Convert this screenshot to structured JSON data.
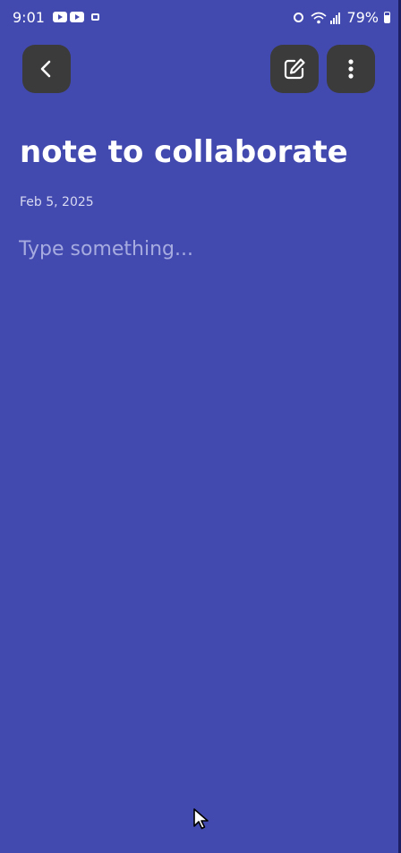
{
  "status_bar": {
    "time": "9:01",
    "battery": "79%"
  },
  "toolbar": {
    "back_icon": "chevron-left-icon",
    "edit_icon": "edit-icon",
    "more_icon": "more-vert-icon",
    "button_color": "#3b3b3b"
  },
  "note": {
    "title": "note to collaborate",
    "date": "Feb 5, 2025",
    "body": "",
    "body_placeholder": "Type something..."
  },
  "colors": {
    "background": "#434aaf",
    "text": "#ffffff",
    "placeholder": "#a6abe0"
  }
}
